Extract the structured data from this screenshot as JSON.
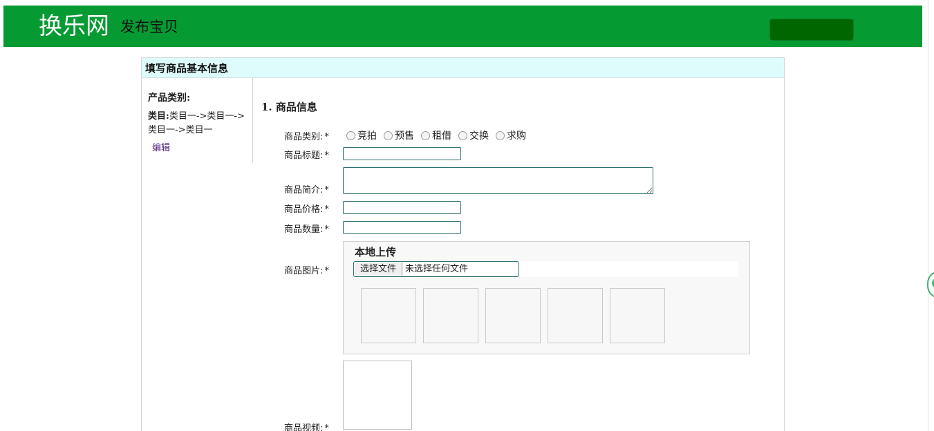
{
  "header": {
    "brand": "换乐网",
    "subtitle": "发布宝贝",
    "accent_color": "#069a33"
  },
  "panel": {
    "title": "填写商品基本信息"
  },
  "category": {
    "heading": "产品类别:",
    "path_label": "类目:",
    "path_value": "类目一->类目一->类目一->类目一",
    "edit_link": "编辑"
  },
  "form": {
    "section_title": "1. 商品信息",
    "required_mark": "*",
    "type_label": "商品类别:",
    "type_options": [
      "竞拍",
      "预售",
      "租借",
      "交换",
      "求购"
    ],
    "title_label": "商品标题:",
    "title_value": "",
    "intro_label": "商品简介:",
    "intro_value": "",
    "price_label": "商品价格:",
    "price_value": "",
    "quantity_label": "商品数量:",
    "quantity_value": "",
    "image_label": "商品图片:",
    "video_label": "商品视频:"
  },
  "upload": {
    "title": "本地上传",
    "choose_button": "选择文件",
    "no_file_text": "未选择任何文件"
  }
}
